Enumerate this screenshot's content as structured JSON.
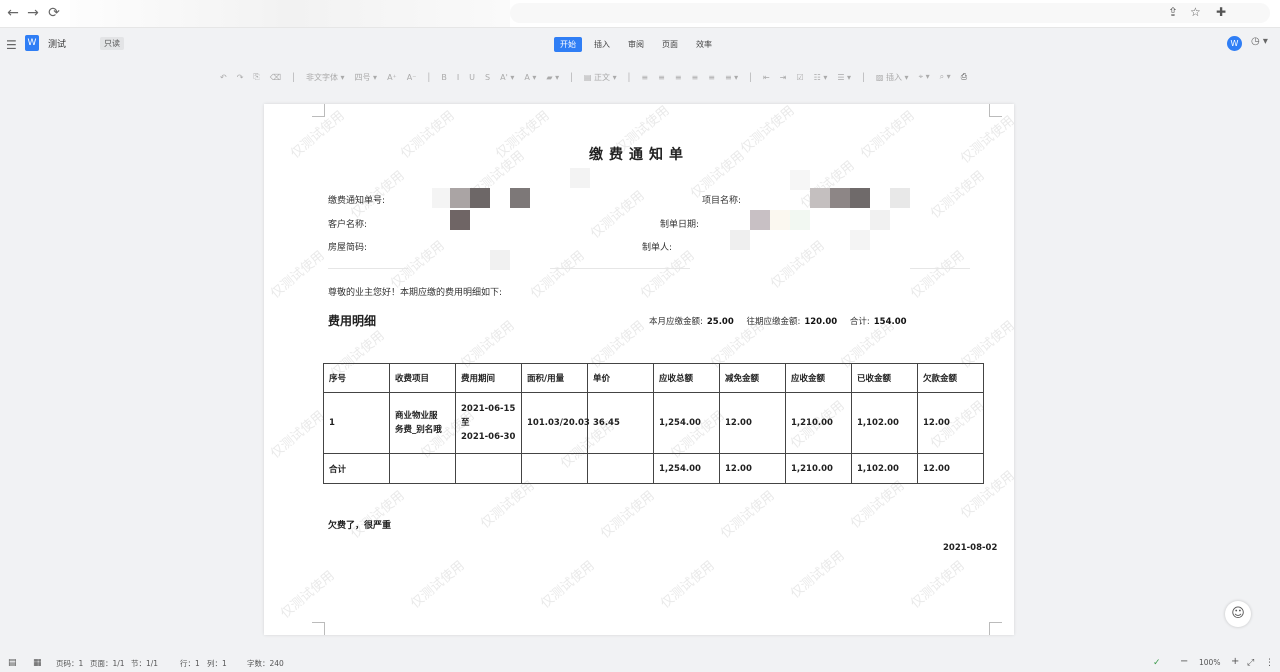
{
  "browser": {
    "back_icon": "←",
    "forward_icon": "→",
    "reload_icon": "⟳",
    "share_icon": "⇪",
    "star_icon": "☆",
    "extension_icon": "✚"
  },
  "app": {
    "menu_icon": "☰",
    "doc_icon": "W",
    "doc_title": "测试",
    "readonly_badge": "只读",
    "tabs": [
      {
        "label": "开始",
        "active": true
      },
      {
        "label": "插入",
        "active": false
      },
      {
        "label": "审阅",
        "active": false
      },
      {
        "label": "页面",
        "active": false
      },
      {
        "label": "效率",
        "active": false
      }
    ],
    "wps_icon": "W",
    "history_icon": "◷ ▾"
  },
  "toolbar": {
    "items": [
      "↶",
      "↷",
      "⎘",
      "⌫",
      "│",
      "非文字体 ▾",
      "四号 ▾",
      "A⁺",
      "A⁻",
      "│",
      "B",
      "I",
      "U",
      "S",
      "A' ▾",
      "A ▾",
      "▰ ▾",
      "│",
      "▤ 正文 ▾",
      "│",
      "≡",
      "≡",
      "≡",
      "≡",
      "≡",
      "≡ ▾",
      "│",
      "⇤",
      "⇥",
      "☑",
      "☷ ▾",
      "☰ ▾",
      "│",
      "▨ 插入 ▾",
      "⌖ ▾",
      "⌕ ▾",
      "⎙"
    ]
  },
  "document": {
    "heading": "缴费通知单",
    "fields": {
      "notice_no": "缴费通知单号:",
      "project_name": "项目名称:",
      "customer_name": "客户名称:",
      "created_date": "制单日期:",
      "house_code": "房屋简码:",
      "creator": "制单人:"
    },
    "greeting": "尊敬的业主您好！本期应缴的费用明细如下:",
    "section_title": "费用明细",
    "summary": {
      "current_label": "本月应缴金额:",
      "current_value": "25.00",
      "previous_label": "往期应缴金额:",
      "previous_value": "120.00",
      "total_label": "合计:",
      "total_value": "154.00"
    },
    "table": {
      "headers": [
        "序号",
        "收费项目",
        "费用期间",
        "面积/用量",
        "单价",
        "应收总额",
        "减免金额",
        "应收金额",
        "已收金额",
        "欠款金额"
      ],
      "row": {
        "no": "1",
        "item_line1": "商业物业服",
        "item_line2": "务费_别名哦",
        "period_start": "2021-06-15",
        "period_to": "至",
        "period_end": "2021-06-30",
        "usage": "101.03/20.03",
        "unit_price": "36.45",
        "total_due": "1,254.00",
        "discount": "12.00",
        "receivable": "1,210.00",
        "received": "1,102.00",
        "arrears": "12.00"
      },
      "total_row": {
        "label": "合计",
        "total_due": "1,254.00",
        "discount": "12.00",
        "receivable": "1,210.00",
        "received": "1,102.00",
        "arrears": "12.00"
      }
    },
    "note": "欠费了，很严重",
    "date": "2021-08-02",
    "watermark": "仅测试使用"
  },
  "assistant_icon": "☺",
  "statusbar": {
    "page_code": "页码：1",
    "pages": "页面：1/1",
    "section": "节：1/1",
    "row": "行：1",
    "col": "列：1",
    "word_count": "字数：240",
    "zoom": "100%",
    "zoom_out_icon": "−",
    "zoom_in_icon": "+",
    "fit_icon": "⤢",
    "more_icon": "⋮"
  }
}
